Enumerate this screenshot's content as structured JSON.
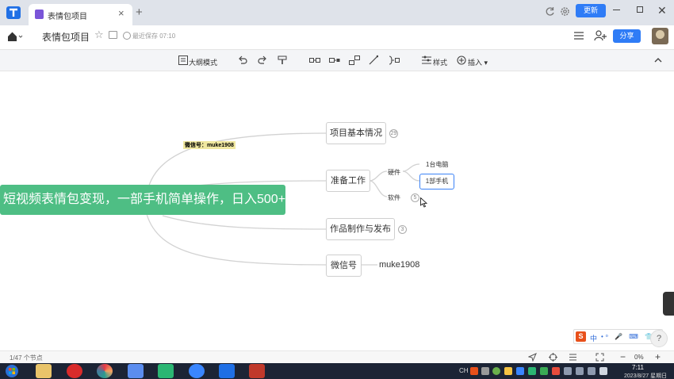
{
  "browser": {
    "tab_title": "表情包项目",
    "tab_close": "×",
    "new_tab": "+",
    "update_label": "更新",
    "close_window": "✕"
  },
  "header": {
    "doc_title": "表情包项目",
    "star": "☆",
    "save_status": "最近保存 07:10",
    "share_label": "分享"
  },
  "toolbar": {
    "outline_label": "大纲模式",
    "style_label": "样式",
    "insert_label": "插入",
    "insert_caret": "▾"
  },
  "mindmap": {
    "root": "短视频表情包变现，一部手机简单操作，日入500+",
    "branches": [
      {
        "label": "项目基本情况",
        "badge": "29"
      },
      {
        "label": "准备工作",
        "badge": ""
      },
      {
        "label": "作品制作与发布",
        "badge": "3"
      },
      {
        "label": "微信号",
        "badge": ""
      }
    ],
    "prep_children": {
      "hardware": "硬件",
      "software": "软件",
      "software_badge": "5",
      "hardware_items": [
        "1台电脑",
        "1部手机"
      ]
    },
    "wechat_value": "muke1908",
    "floating_caption": "微信号：muke1908"
  },
  "ime": {
    "logo": "S",
    "mode": "中",
    "icons": "•ᵒ 🎤 ⌨ 👕 ⊞"
  },
  "help": "?",
  "status": {
    "node_count": "1/47 个节点",
    "zoom_minus": "−",
    "zoom_level": "0%",
    "zoom_plus": "+"
  },
  "taskbar": {
    "tray_text": "CH",
    "clock_time": "7:11",
    "clock_date": "2023/8/27 星期日"
  },
  "colors": {
    "root_green": "#4ebe84",
    "accent_blue": "#2f7cf6",
    "selected_border": "#3b82f6",
    "ime_orange": "#e8501a",
    "taskbar_bg": "#1c2435"
  }
}
